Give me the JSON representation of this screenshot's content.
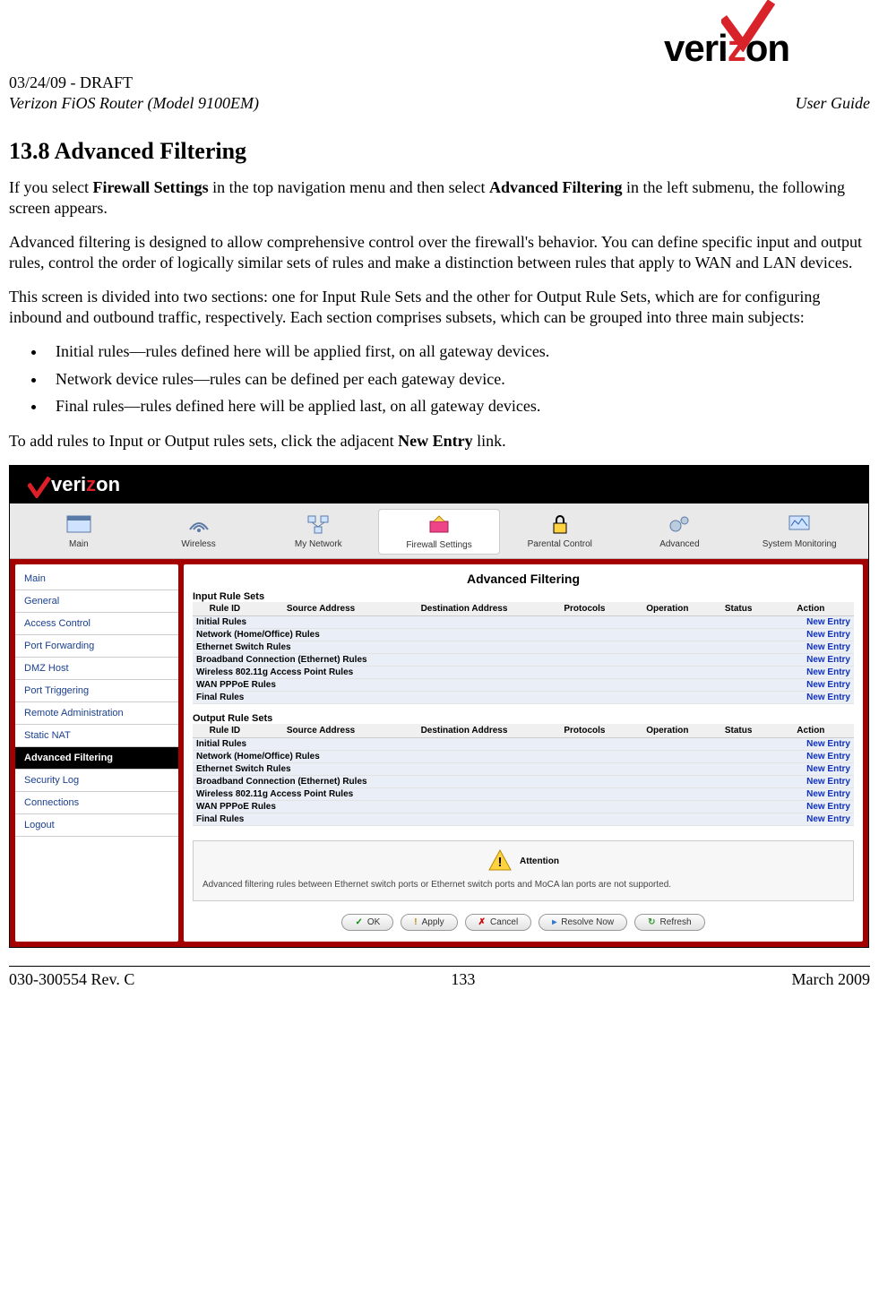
{
  "header": {
    "logo_text": "verizon",
    "draft": "03/24/09 - DRAFT",
    "product": "Verizon FiOS Router (Model 9100EM)",
    "doc_type": "User Guide"
  },
  "section": {
    "number_title": "13.8   Advanced Filtering",
    "p1_pre": "If you select ",
    "p1_b1": "Firewall Settings",
    "p1_mid": " in the top navigation menu and then select ",
    "p1_b2": "Advanced Filtering",
    "p1_post": " in the left submenu, the following screen appears.",
    "p2": "Advanced filtering is designed to allow comprehensive control over the firewall's behavior. You can define specific input and output rules, control the order of logically similar sets of rules and make a distinction between rules that apply to WAN and LAN devices.",
    "p3": "This screen is divided into two sections: one for Input Rule Sets and the other for Output Rule Sets, which are for configuring inbound and outbound traffic, respectively. Each section comprises subsets, which can be grouped into three main subjects:",
    "bullets": [
      "Initial rules—rules defined here will be applied first, on all gateway devices.",
      "Network device rules—rules can be defined per each gateway device.",
      "Final rules—rules defined here will be applied last, on all gateway devices."
    ],
    "p4_pre": "To add rules to Input or Output rules sets, click the adjacent ",
    "p4_b": "New Entry",
    "p4_post": " link."
  },
  "screenshot": {
    "nav": [
      {
        "label": "Main",
        "icon": "window-icon"
      },
      {
        "label": "Wireless",
        "icon": "wireless-icon"
      },
      {
        "label": "My Network",
        "icon": "network-icon"
      },
      {
        "label": "Firewall Settings",
        "icon": "firewall-icon"
      },
      {
        "label": "Parental Control",
        "icon": "lock-icon"
      },
      {
        "label": "Advanced",
        "icon": "gears-icon"
      },
      {
        "label": "System Monitoring",
        "icon": "monitor-icon"
      }
    ],
    "nav_active_index": 3,
    "sidebar": [
      "Main",
      "General",
      "Access Control",
      "Port Forwarding",
      "DMZ Host",
      "Port Triggering",
      "Remote Administration",
      "Static NAT",
      "Advanced Filtering",
      "Security Log",
      "Connections",
      "Logout"
    ],
    "sidebar_active_index": 8,
    "panel_title": "Advanced Filtering",
    "columns": [
      "Rule ID",
      "Source Address",
      "Destination Address",
      "Protocols",
      "Operation",
      "Status",
      "Action"
    ],
    "input_label": "Input Rule Sets",
    "output_label": "Output Rule Sets",
    "rule_names": [
      "Initial Rules",
      "Network (Home/Office) Rules",
      "Ethernet Switch Rules",
      "Broadband Connection (Ethernet) Rules",
      "Wireless 802.11g Access Point Rules",
      "WAN PPPoE Rules",
      "Final Rules"
    ],
    "new_entry": "New Entry",
    "attention_label": "Attention",
    "attention_text": "Advanced filtering rules between Ethernet switch ports or Ethernet switch ports and MoCA lan ports are not supported.",
    "buttons": {
      "ok": "OK",
      "apply": "Apply",
      "cancel": "Cancel",
      "resolve": "Resolve Now",
      "refresh": "Refresh"
    }
  },
  "footer": {
    "left": "030-300554 Rev. C",
    "center": "133",
    "right": "March 2009"
  }
}
